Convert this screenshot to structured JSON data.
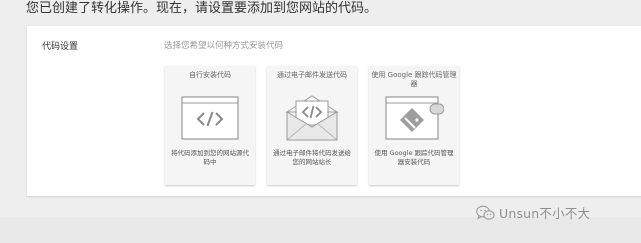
{
  "header": {
    "text": "您已创建了转化操作。现在，请设置要添加到您网站的代码。"
  },
  "code_setup": {
    "label": "代码设置",
    "hint": "选择您希望以何种方式安装代码",
    "options": [
      {
        "title": "自行安装代码",
        "description": "将代码添加到您的网站源代码中",
        "icon": "code-window-icon"
      },
      {
        "title": "通过电子邮件发送代码",
        "description": "通过电子邮件将代码发送给您的网站站长",
        "icon": "envelope-code-icon"
      },
      {
        "title": "使用 Google 跟踪代码管理器",
        "description": "使用 Google 跟踪代码管理器安装代码",
        "icon": "tag-manager-icon"
      }
    ]
  },
  "watermark": {
    "text": "Unsun不小不大",
    "logo": "wechat-logo"
  }
}
